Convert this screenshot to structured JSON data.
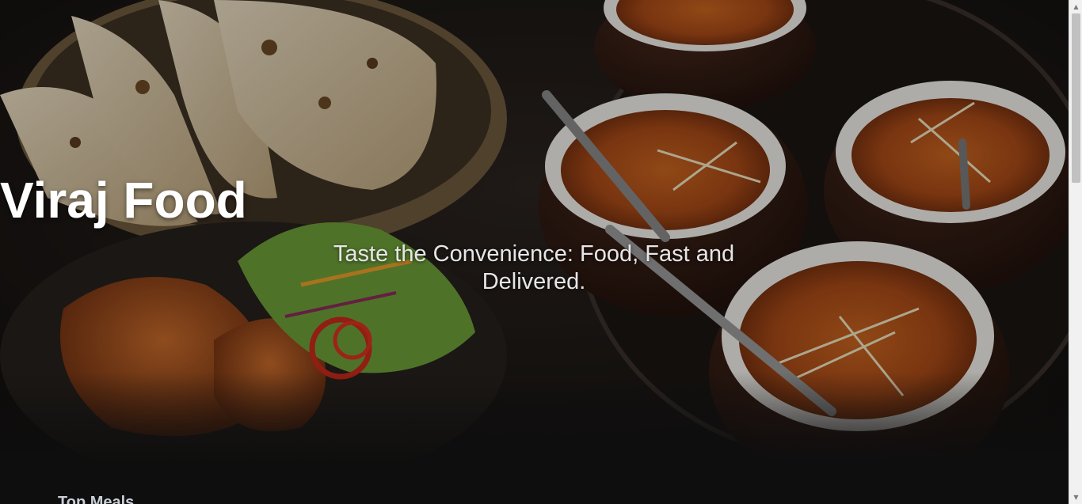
{
  "hero": {
    "title": "Viraj Food",
    "subtitle": "Taste the Convenience: Food, Fast and Delivered."
  },
  "sections": {
    "top_meals_heading": "Top Meals"
  },
  "icons": {
    "scroll_up": "scroll-up-arrow-icon",
    "scroll_down": "scroll-down-arrow-icon"
  },
  "colors": {
    "page_background": "#0e0e0e",
    "title_color": "#ffffff",
    "subtitle_color": "#e6e6e6",
    "heading_color": "#c9ced6"
  }
}
